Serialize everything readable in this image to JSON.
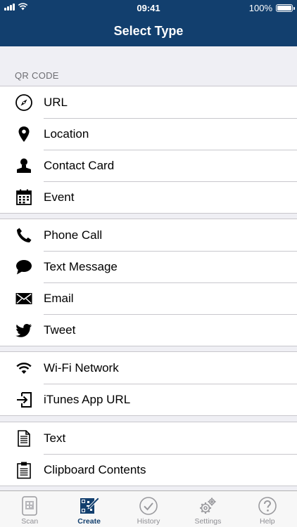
{
  "status_bar": {
    "time": "09:41",
    "battery": "100%"
  },
  "nav": {
    "title": "Select Type"
  },
  "section": {
    "header": "QR CODE"
  },
  "groups": [
    {
      "items": [
        {
          "label": "URL",
          "icon": "compass-icon"
        },
        {
          "label": "Location",
          "icon": "map-pin-icon"
        },
        {
          "label": "Contact Card",
          "icon": "person-icon"
        },
        {
          "label": "Event",
          "icon": "calendar-icon"
        }
      ]
    },
    {
      "items": [
        {
          "label": "Phone Call",
          "icon": "phone-icon"
        },
        {
          "label": "Text Message",
          "icon": "speech-bubble-icon"
        },
        {
          "label": "Email",
          "icon": "envelope-icon"
        },
        {
          "label": "Tweet",
          "icon": "twitter-bird-icon"
        }
      ]
    },
    {
      "items": [
        {
          "label": "Wi-Fi Network",
          "icon": "wifi-icon"
        },
        {
          "label": "iTunes App URL",
          "icon": "app-enter-icon"
        }
      ]
    },
    {
      "items": [
        {
          "label": "Text",
          "icon": "document-icon"
        },
        {
          "label": "Clipboard Contents",
          "icon": "clipboard-icon"
        }
      ]
    }
  ],
  "tabs": [
    {
      "label": "Scan",
      "icon": "scan-qr-icon",
      "active": false
    },
    {
      "label": "Create",
      "icon": "create-qr-icon",
      "active": true
    },
    {
      "label": "History",
      "icon": "checkmark-circle-icon",
      "active": false
    },
    {
      "label": "Settings",
      "icon": "gears-icon",
      "active": false
    },
    {
      "label": "Help",
      "icon": "question-icon",
      "active": false
    }
  ],
  "colors": {
    "navbar": "#123f6e",
    "background": "#efeff4",
    "tab_inactive": "#8e8e93"
  }
}
